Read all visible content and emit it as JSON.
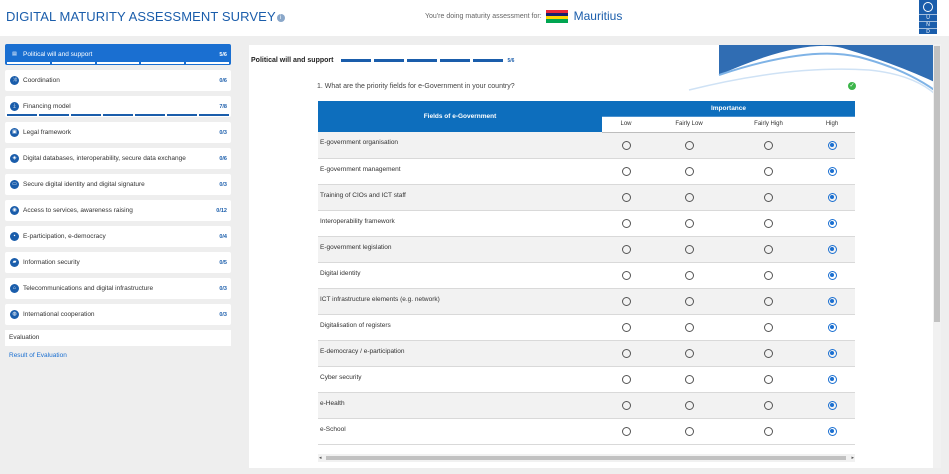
{
  "header": {
    "title": "DIGITAL MATURITY ASSESSMENT SURVEY",
    "assessment_label": "You're doing maturity assessment for:",
    "country": "Mauritius",
    "flag_colors": [
      "#ea2839",
      "#1a206d",
      "#ffd500",
      "#00a551"
    ],
    "logo_lines": [
      "U",
      "N",
      "D",
      "P"
    ]
  },
  "sidebar": {
    "items": [
      {
        "label": "Political will and support",
        "count": "5/6",
        "icon": "document-icon",
        "progress": 5,
        "active": true
      },
      {
        "label": "Coordination",
        "count": "0/6",
        "icon": "shuffle-icon"
      },
      {
        "label": "Financing model",
        "count": "7/8",
        "icon": "download-icon",
        "progress": 7
      },
      {
        "label": "Legal framework",
        "count": "0/3",
        "icon": "briefcase-icon"
      },
      {
        "label": "Digital databases, interoperability, secure data exchange",
        "count": "0/6",
        "icon": "shield-icon"
      },
      {
        "label": "Secure digital identity and digital signature",
        "count": "0/3",
        "icon": "id-card-icon"
      },
      {
        "label": "Access to services, awareness raising",
        "count": "0/12",
        "icon": "users-icon"
      },
      {
        "label": "E-participation, e-democracy",
        "count": "0/4",
        "icon": "chat-icon"
      },
      {
        "label": "Information security",
        "count": "0/5",
        "icon": "lock-icon"
      },
      {
        "label": "Telecommunications and digital infrastructure",
        "count": "0/3",
        "icon": "bank-icon"
      },
      {
        "label": "International cooperation",
        "count": "0/3",
        "icon": "globe-icon"
      }
    ],
    "evaluation": "Evaluation",
    "result_link": "Result of Evaluation"
  },
  "main": {
    "section_title": "Political will and support",
    "section_count": "5/6",
    "question": "1. What are the priority fields for e-Government in your country?",
    "table": {
      "fields_header": "Fields of e-Government",
      "importance_header": "Importance",
      "levels": [
        "Low",
        "Fairly Low",
        "Fairly High",
        "High"
      ],
      "rows": [
        {
          "label": "E-government organisation",
          "selected": 3
        },
        {
          "label": "E-government management",
          "selected": 3
        },
        {
          "label": "Training of CIOs and ICT staff",
          "selected": 3
        },
        {
          "label": "Interoperability framework",
          "selected": 3
        },
        {
          "label": "E-government legislation",
          "selected": 3
        },
        {
          "label": "Digital identity",
          "selected": 3
        },
        {
          "label": "ICT infrastructure elements (e.g. network)",
          "selected": 3
        },
        {
          "label": "Digitalisation of registers",
          "selected": 3
        },
        {
          "label": "E-democracy / e-participation",
          "selected": 3
        },
        {
          "label": "Cyber security",
          "selected": 3
        },
        {
          "label": "e-Health",
          "selected": 3
        },
        {
          "label": "e-School",
          "selected": 3
        }
      ]
    }
  },
  "colors": {
    "accent": "#1a5dab",
    "active_nav": "#1a6fd1",
    "table_header": "#0d6ebd",
    "check": "#3cb54a"
  }
}
